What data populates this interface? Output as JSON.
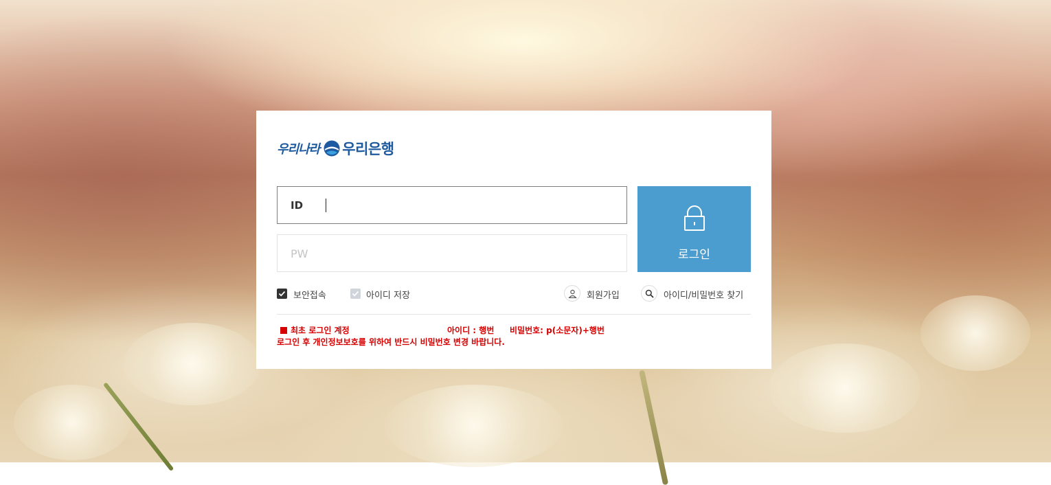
{
  "brand": {
    "script_text": "우리나라",
    "bank_name": "우리은행",
    "accent_color": "#1e5aa0"
  },
  "form": {
    "id_label": "ID",
    "id_value": "",
    "pw_label": "PW",
    "pw_value": ""
  },
  "login_button": {
    "label": "로그인",
    "icon": "lock-icon",
    "color": "#4b9ccf"
  },
  "options": {
    "secure_connection": {
      "label": "보안접속",
      "checked": true
    },
    "save_id": {
      "label": "아이디 저장",
      "checked": true,
      "disabled": true
    },
    "signup": {
      "label": "회원가입",
      "icon": "user-icon"
    },
    "find_account": {
      "label": "아이디/비밀번호 찾기",
      "icon": "search-icon"
    }
  },
  "notice": {
    "title": "최초 로그인 계정",
    "id_info": "아이디 : 행번",
    "pw_info": "비밀번호: p(소문자)+행번",
    "message": "로그인 후 개인정보보호를 위하여 반드시 비밀번호 변경 바랍니다.",
    "color": "#d60000"
  }
}
